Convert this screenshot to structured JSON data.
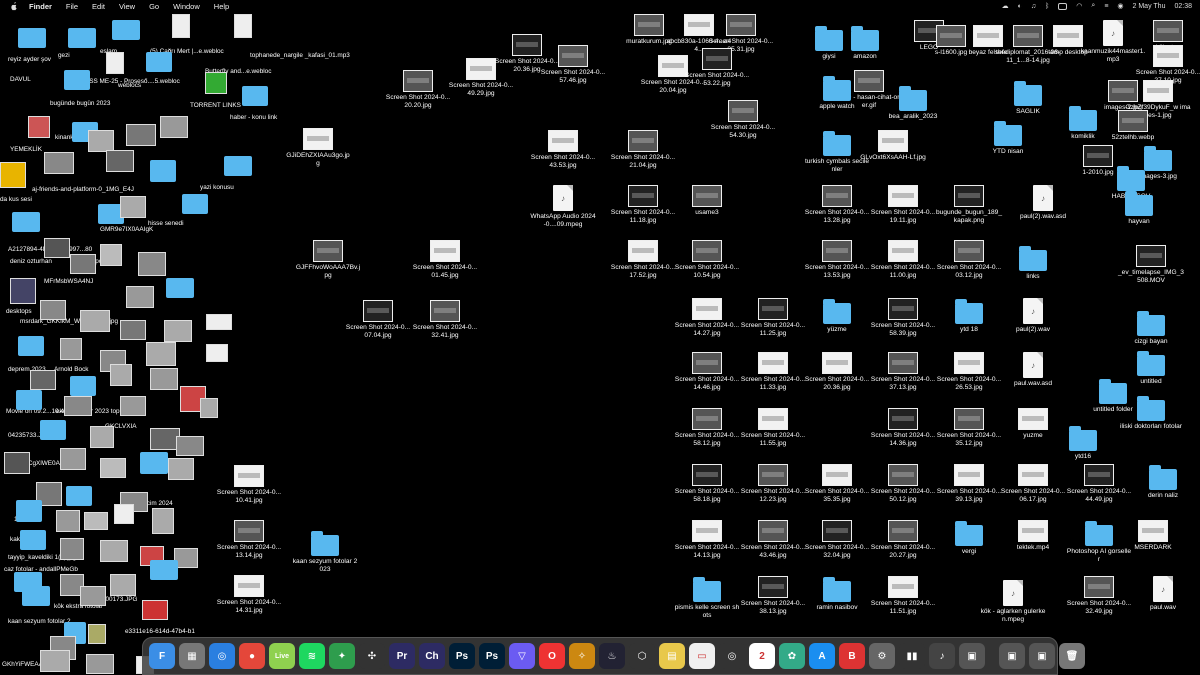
{
  "menubar": {
    "app": "Finder",
    "items": [
      "File",
      "Edit",
      "View",
      "Go",
      "Window",
      "Help"
    ],
    "date": "2 May Thu",
    "time": "02:38"
  },
  "left_labels": [
    "reyiz ayder şov",
    "gezi",
    "eslam",
    "(5) Çağrı Mert |...e.webloc",
    "tophanede_nargile _kafasi_01.mp3",
    "DAVUL",
    "BOSS ME-25 - Proseső....5.webloc",
    "weblocs",
    "Butterfly and...e.webloc",
    "TORRENT LINKS",
    "bugünde bugün 2023",
    "haber - konu link",
    "YEMEKLİK",
    "kinankaan",
    "yazi konusu",
    "da kus sesi",
    "aj-friends-and-platform-0_1MG_E4J",
    "hisse senedi",
    "A2127894-4B88-188-997...80",
    "deniz ozturhan",
    "spor",
    "GMR9e7IX0AAIgK",
    "desktops",
    "MFrMsbWSA4NJ",
    "msrdark_GKKfkM_WOAAC7Ef.jpg",
    "deprem 2023",
    "Arnold Bock",
    "Movie on 09.2...10.42",
    "ekode fotolar 2023 toplama",
    "04235733.JPG",
    "GI_GRCgXlWE0AA",
    "secim 2024",
    "GKCLVXIA",
    "1200x",
    "kakule",
    "tayyip_kaveldiki 1(1).jpg",
    "caz fotolar - andallPMeGb",
    "kök ekstra fotolar",
    "DSC00173.JPG",
    "kaan sezyum fotolar 2",
    "e3311e16-614d-47b4-b1",
    "GKhYiFWEAAhX"
  ],
  "items": [
    {
      "label": "Screen Shot 2024-0...20.20.jpg",
      "icon": "thumb"
    },
    {
      "label": "Screen Shot 2024-0...49.29.jpg",
      "icon": "thumb"
    },
    {
      "label": "Screen Shot 2024-0...20.36.jpg",
      "icon": "thumb"
    },
    {
      "label": "Screen Shot 2024-0...57.46.jpg",
      "icon": "thumb"
    },
    {
      "label": "GJiDEhZXIAAu3go.jpg",
      "icon": "thumb"
    },
    {
      "label": "GJFFhvoWoAAA7Bv.jpg",
      "icon": "thumb"
    },
    {
      "label": "Screen Shot 2024-0...01.45.jpg",
      "icon": "thumb"
    },
    {
      "label": "Screen Shot 2024-0...07.04.jpg",
      "icon": "thumb"
    },
    {
      "label": "Screen Shot 2024-0...32.41.jpg",
      "icon": "thumb"
    },
    {
      "label": "Screen Shot 2024-0...10.41.jpg",
      "icon": "thumb"
    },
    {
      "label": "Screen Shot 2024-0...13.14.jpg",
      "icon": "thumb"
    },
    {
      "label": "Screen Shot 2024-0...14.31.jpg",
      "icon": "thumb"
    },
    {
      "label": "kaan sezyum fotolar 2023",
      "icon": "folder"
    },
    {
      "label": "muratkurum.jpg",
      "icon": "thumb"
    },
    {
      "label": "abcb830a-1060-4...a44...",
      "icon": "thumb"
    },
    {
      "label": "Screen Shot 2024-0...35.31.jpg",
      "icon": "thumb"
    },
    {
      "label": "Screen Shot 2024-0...20.04.jpg",
      "icon": "thumb"
    },
    {
      "label": "Screen Shot 2024-0...53.22.jpg",
      "icon": "thumb"
    },
    {
      "label": "Screen Shot 2024-0...54.30.jpg",
      "icon": "thumb"
    },
    {
      "label": "Screen Shot 2024-0...43.53.jpg",
      "icon": "thumb"
    },
    {
      "label": "Screen Shot 2024-0...21.04.jpg",
      "icon": "thumb"
    },
    {
      "label": "WhatsApp Audio 2024-0....09.mpeg",
      "icon": "doc"
    },
    {
      "label": "Screen Shot 2024-0...11.18.jpg",
      "icon": "thumb"
    },
    {
      "label": "usame3",
      "icon": "thumb"
    },
    {
      "label": "Screen Shot 2024-0...17.52.jpg",
      "icon": "thumb"
    },
    {
      "label": "Screen Shot 2024-0...10.54.jpg",
      "icon": "thumb"
    },
    {
      "label": "Screen Shot 2024-0...14.27.jpg",
      "icon": "thumb"
    },
    {
      "label": "Screen Shot 2024-0...11.25.jpg",
      "icon": "thumb"
    },
    {
      "label": "Screen Shot 2024-0...14.46.jpg",
      "icon": "thumb"
    },
    {
      "label": "Screen Shot 2024-0...11.33.jpg",
      "icon": "thumb"
    },
    {
      "label": "Screen Shot 2024-0...58.12.jpg",
      "icon": "thumb"
    },
    {
      "label": "Screen Shot 2024-0...11.55.jpg",
      "icon": "thumb"
    },
    {
      "label": "Screen Shot 2024-0...58.18.jpg",
      "icon": "thumb"
    },
    {
      "label": "Screen Shot 2024-0...12.23.jpg",
      "icon": "thumb"
    },
    {
      "label": "Screen Shot 2024-0...14.13.jpg",
      "icon": "thumb"
    },
    {
      "label": "Screen Shot 2024-0...43.46.jpg",
      "icon": "thumb"
    },
    {
      "label": "pismis kelle screen shots",
      "icon": "folder"
    },
    {
      "label": "Screen Shot 2024-0...38.13.jpg",
      "icon": "thumb"
    },
    {
      "label": "giysi",
      "icon": "folder"
    },
    {
      "label": "amazon",
      "icon": "folder"
    },
    {
      "label": "HCO - hasan-cihat-orter.gif",
      "icon": "thumb"
    },
    {
      "label": "apple watch",
      "icon": "folder"
    },
    {
      "label": "bea_aralik_2023",
      "icon": "folder"
    },
    {
      "label": "turkish cymbals secilenler",
      "icon": "folder"
    },
    {
      "label": "GLvOxt6XsAAH-Lf.jpg",
      "icon": "thumb"
    },
    {
      "label": "Screen Shot 2024-0...13.28.jpg",
      "icon": "thumb"
    },
    {
      "label": "Screen Shot 2024-0...19.11.jpg",
      "icon": "thumb"
    },
    {
      "label": "bugunde_bugun_189_kapak.png",
      "icon": "thumb"
    },
    {
      "label": "Screen Shot 2024-0...13.53.jpg",
      "icon": "thumb"
    },
    {
      "label": "Screen Shot 2024-0...11.00.jpg",
      "icon": "thumb"
    },
    {
      "label": "Screen Shot 2024-0...03.12.jpg",
      "icon": "thumb"
    },
    {
      "label": "yüzme",
      "icon": "folder"
    },
    {
      "label": "Screen Shot 2024-0...58.39.jpg",
      "icon": "thumb"
    },
    {
      "label": "ytd 18",
      "icon": "folder"
    },
    {
      "label": "Screen Shot 2024-0...20.36.jpg",
      "icon": "thumb"
    },
    {
      "label": "Screen Shot 2024-0...37.13.jpg",
      "icon": "thumb"
    },
    {
      "label": "Screen Shot 2024-0...26.53.jpg",
      "icon": "thumb"
    },
    {
      "label": "Screen Shot 2024-0...14.36.jpg",
      "icon": "thumb"
    },
    {
      "label": "Screen Shot 2024-0...35.12.jpg",
      "icon": "thumb"
    },
    {
      "label": "Screen Shot 2024-0...35.35.jpg",
      "icon": "thumb"
    },
    {
      "label": "Screen Shot 2024-0...50.12.jpg",
      "icon": "thumb"
    },
    {
      "label": "Screen Shot 2024-0...39.13.jpg",
      "icon": "thumb"
    },
    {
      "label": "Screen Shot 2024-0...32.04.jpg",
      "icon": "thumb"
    },
    {
      "label": "Screen Shot 2024-0...20.27.jpg",
      "icon": "thumb"
    },
    {
      "label": "vergi",
      "icon": "folder"
    },
    {
      "label": "ramin nasibov",
      "icon": "folder"
    },
    {
      "label": "Screen Shot 2024-0...11.51.jpg",
      "icon": "thumb"
    },
    {
      "label": "LEGO",
      "icon": "thumb"
    },
    {
      "label": "s-l1600.jpg",
      "icon": "thumb"
    },
    {
      "label": "beyaz felsefe",
      "icon": "thumb"
    },
    {
      "label": "thediplomat_2016-06-11_1...8-14.jpg",
      "icon": "thumb"
    },
    {
      "label": "tamp desktop",
      "icon": "thumb"
    },
    {
      "label": "kaanmuzik44master1.mp3",
      "icon": "doc"
    },
    {
      "label": "billgates",
      "icon": "thumb"
    },
    {
      "label": "Screen Shot 2024-0...27.10.jpg",
      "icon": "thumb"
    },
    {
      "label": "SAGLIK",
      "icon": "folder"
    },
    {
      "label": "YTD nisan",
      "icon": "folder"
    },
    {
      "label": "komiklik",
      "icon": "folder"
    },
    {
      "label": "images-2.jpg",
      "icon": "thumb"
    },
    {
      "label": "GzhZf39DykuF_w images-1.jpg",
      "icon": "thumb"
    },
    {
      "label": "52ztelhb.webp",
      "icon": "thumb"
    },
    {
      "label": "images-3.jpg",
      "icon": "folder"
    },
    {
      "label": "1-2010.jpg",
      "icon": "thumb"
    },
    {
      "label": "HABER ŞOV",
      "icon": "folder"
    },
    {
      "label": "paul(2).wav.asd",
      "icon": "doc"
    },
    {
      "label": "hayvan",
      "icon": "folder"
    },
    {
      "label": "links",
      "icon": "folder"
    },
    {
      "label": "_ev_timelapse_IMG_3508.MOV",
      "icon": "thumb"
    },
    {
      "label": "paul(2).wav",
      "icon": "doc"
    },
    {
      "label": "cizgi bayan",
      "icon": "folder"
    },
    {
      "label": "paul.wav.asd",
      "icon": "doc"
    },
    {
      "label": "untitled",
      "icon": "folder"
    },
    {
      "label": "untitled folder",
      "icon": "folder"
    },
    {
      "label": "iliski doktorları fotolar",
      "icon": "folder"
    },
    {
      "label": "yuzme",
      "icon": "thumb"
    },
    {
      "label": "ytd16",
      "icon": "folder"
    },
    {
      "label": "Screen Shot 2024-0...06.17.jpg",
      "icon": "thumb"
    },
    {
      "label": "Screen Shot 2024-0...44.49.jpg",
      "icon": "thumb"
    },
    {
      "label": "derin naliz",
      "icon": "folder"
    },
    {
      "label": "tektek.mp4",
      "icon": "thumb"
    },
    {
      "label": "Photoshop AI gorseller",
      "icon": "folder"
    },
    {
      "label": "MSERDARK",
      "icon": "thumb"
    },
    {
      "label": "kök - aglarken gulerken.mpeg",
      "icon": "doc"
    },
    {
      "label": "Screen Shot 2024-0...32.49.jpg",
      "icon": "thumb"
    },
    {
      "label": "paul.wav",
      "icon": "doc"
    }
  ],
  "dock": [
    "F",
    "▦",
    "◎",
    "●",
    "Live",
    "≋",
    "✦",
    "✣",
    "Pr",
    "Ch",
    "Ps",
    "Ps",
    "▽",
    "O",
    "✧",
    "♨",
    "⬡",
    "▤",
    "▭",
    "◎",
    "2",
    "✿",
    "A",
    "B",
    "⚙",
    "▮▮",
    "♪",
    "▣",
    "▣",
    "▣",
    "🗑"
  ],
  "colors": {
    "desktop": "#000000",
    "folder": "#58b8ef",
    "dock": "#3c3c3c"
  }
}
